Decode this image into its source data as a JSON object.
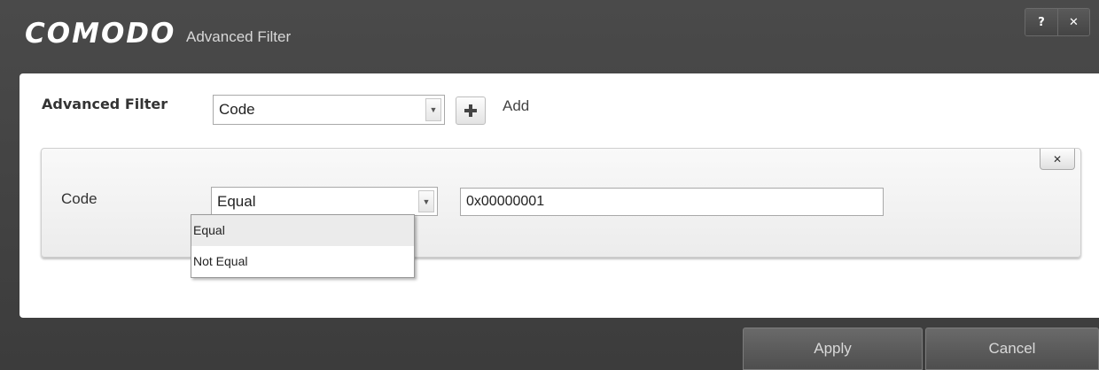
{
  "window": {
    "brand": "COMODO",
    "title": "Advanced Filter",
    "help_label": "?",
    "close_label": "✕"
  },
  "filter": {
    "label": "Advanced Filter",
    "selected_field": "Code",
    "add_label": "Add"
  },
  "condition": {
    "field_label": "Code",
    "operator_value": "Equal",
    "value": "0x00000001",
    "remove_label": "✕",
    "operator_options": [
      "Equal",
      "Not Equal"
    ]
  },
  "footer": {
    "apply_label": "Apply",
    "cancel_label": "Cancel"
  },
  "icons": {
    "dropdown_arrow": "▼",
    "add": "plus-icon"
  }
}
